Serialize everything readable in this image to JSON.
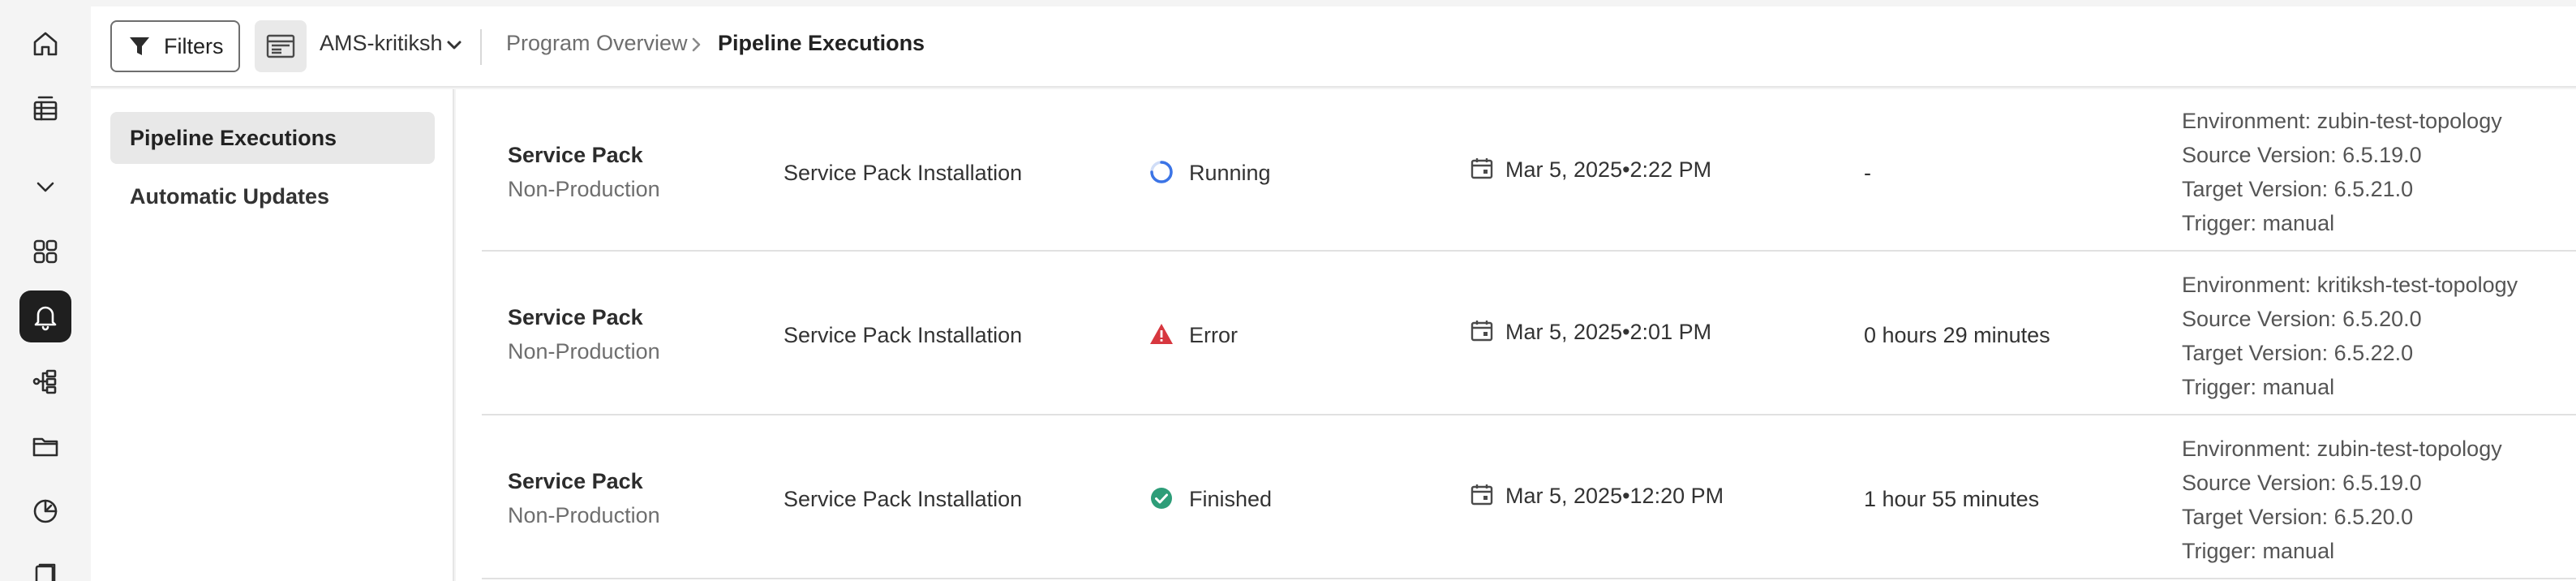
{
  "rail": {
    "icons": [
      "home-icon",
      "table-icon",
      "chevron-down-icon",
      "apps-grid-icon",
      "bell-icon",
      "pipeline-icon",
      "folder-icon",
      "dashboard-icon",
      "reports-icon"
    ]
  },
  "header": {
    "filters_label": "Filters",
    "program_name": "AMS-kritiksh",
    "breadcrumb": [
      "Program Overview",
      "Pipeline Executions"
    ]
  },
  "sidenav": {
    "items": [
      {
        "label": "Pipeline Executions",
        "active": true
      },
      {
        "label": "Automatic Updates",
        "active": false
      }
    ]
  },
  "executions": [
    {
      "type": "Service Pack",
      "environment_type": "Non-Production",
      "name": "Service Pack Installation",
      "status": "Running",
      "status_icon": "spinner-icon",
      "date": "Mar 5, 2025•2:22 PM",
      "duration": "-",
      "details": [
        "Environment: zubin-test-topology",
        "Source Version: 6.5.19.0",
        "Target Version: 6.5.21.0",
        "Trigger: manual"
      ]
    },
    {
      "type": "Service Pack",
      "environment_type": "Non-Production",
      "name": "Service Pack Installation",
      "status": "Error",
      "status_icon": "alert-triangle-icon",
      "date": "Mar 5, 2025•2:01 PM",
      "duration": "0 hours 29 minutes",
      "details": [
        "Environment: kritiksh-test-topology",
        "Source Version: 6.5.20.0",
        "Target Version: 6.5.22.0",
        "Trigger: manual"
      ]
    },
    {
      "type": "Service Pack",
      "environment_type": "Non-Production",
      "name": "Service Pack Installation",
      "status": "Finished",
      "status_icon": "check-circle-icon",
      "date": "Mar 5, 2025•12:20 PM",
      "duration": "1 hour 55 minutes",
      "details": [
        "Environment: zubin-test-topology",
        "Source Version: 6.5.19.0",
        "Target Version: 6.5.20.0",
        "Trigger: manual"
      ]
    }
  ],
  "colors": {
    "running": "#3b74e6",
    "error": "#d7373f",
    "finished": "#2d9d78"
  }
}
